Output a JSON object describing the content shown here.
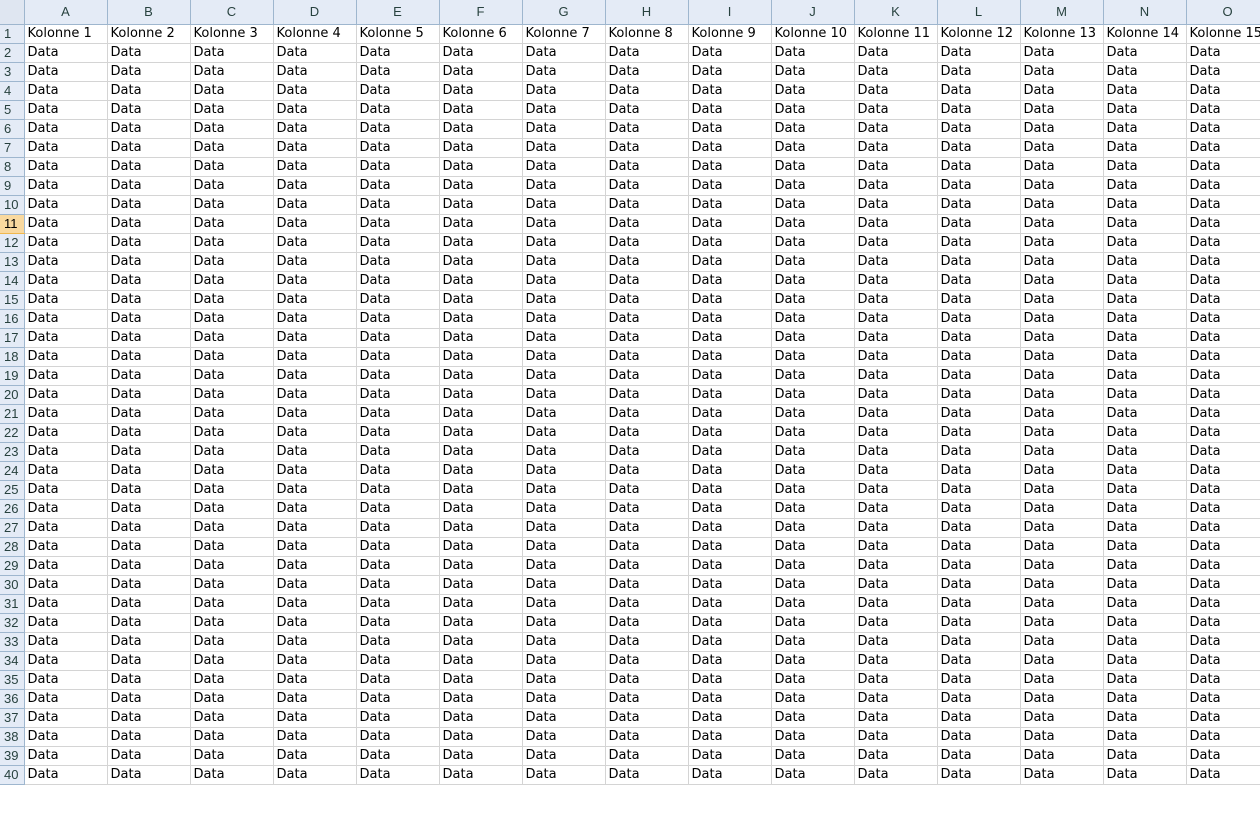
{
  "sheet": {
    "columns": [
      "A",
      "B",
      "C",
      "D",
      "E",
      "F",
      "G",
      "H",
      "I",
      "J",
      "K",
      "L",
      "M",
      "N",
      "O"
    ],
    "active_row": 11,
    "row_numbers": [
      1,
      2,
      3,
      4,
      5,
      6,
      7,
      8,
      9,
      10,
      11,
      12,
      13,
      14,
      15,
      16,
      17,
      18,
      19,
      20,
      21,
      22,
      23,
      24,
      25,
      26,
      27,
      28,
      29,
      30,
      31,
      32,
      33,
      34,
      35,
      36,
      37,
      38,
      39,
      40
    ],
    "header_row": [
      "Kolonne 1",
      "Kolonne 2",
      "Kolonne 3",
      "Kolonne 4",
      "Kolonne 5",
      "Kolonne 6",
      "Kolonne 7",
      "Kolonne 8",
      "Kolonne 9",
      "Kolonne 10",
      "Kolonne 11",
      "Kolonne 12",
      "Kolonne 13",
      "Kolonne 14",
      "Kolonne 15"
    ],
    "cell_value": "Data"
  },
  "colors": {
    "header_bg": "#e4ebf6",
    "active_row_header_bg": "#f9d99f",
    "gridline": "#d4d4d4"
  }
}
